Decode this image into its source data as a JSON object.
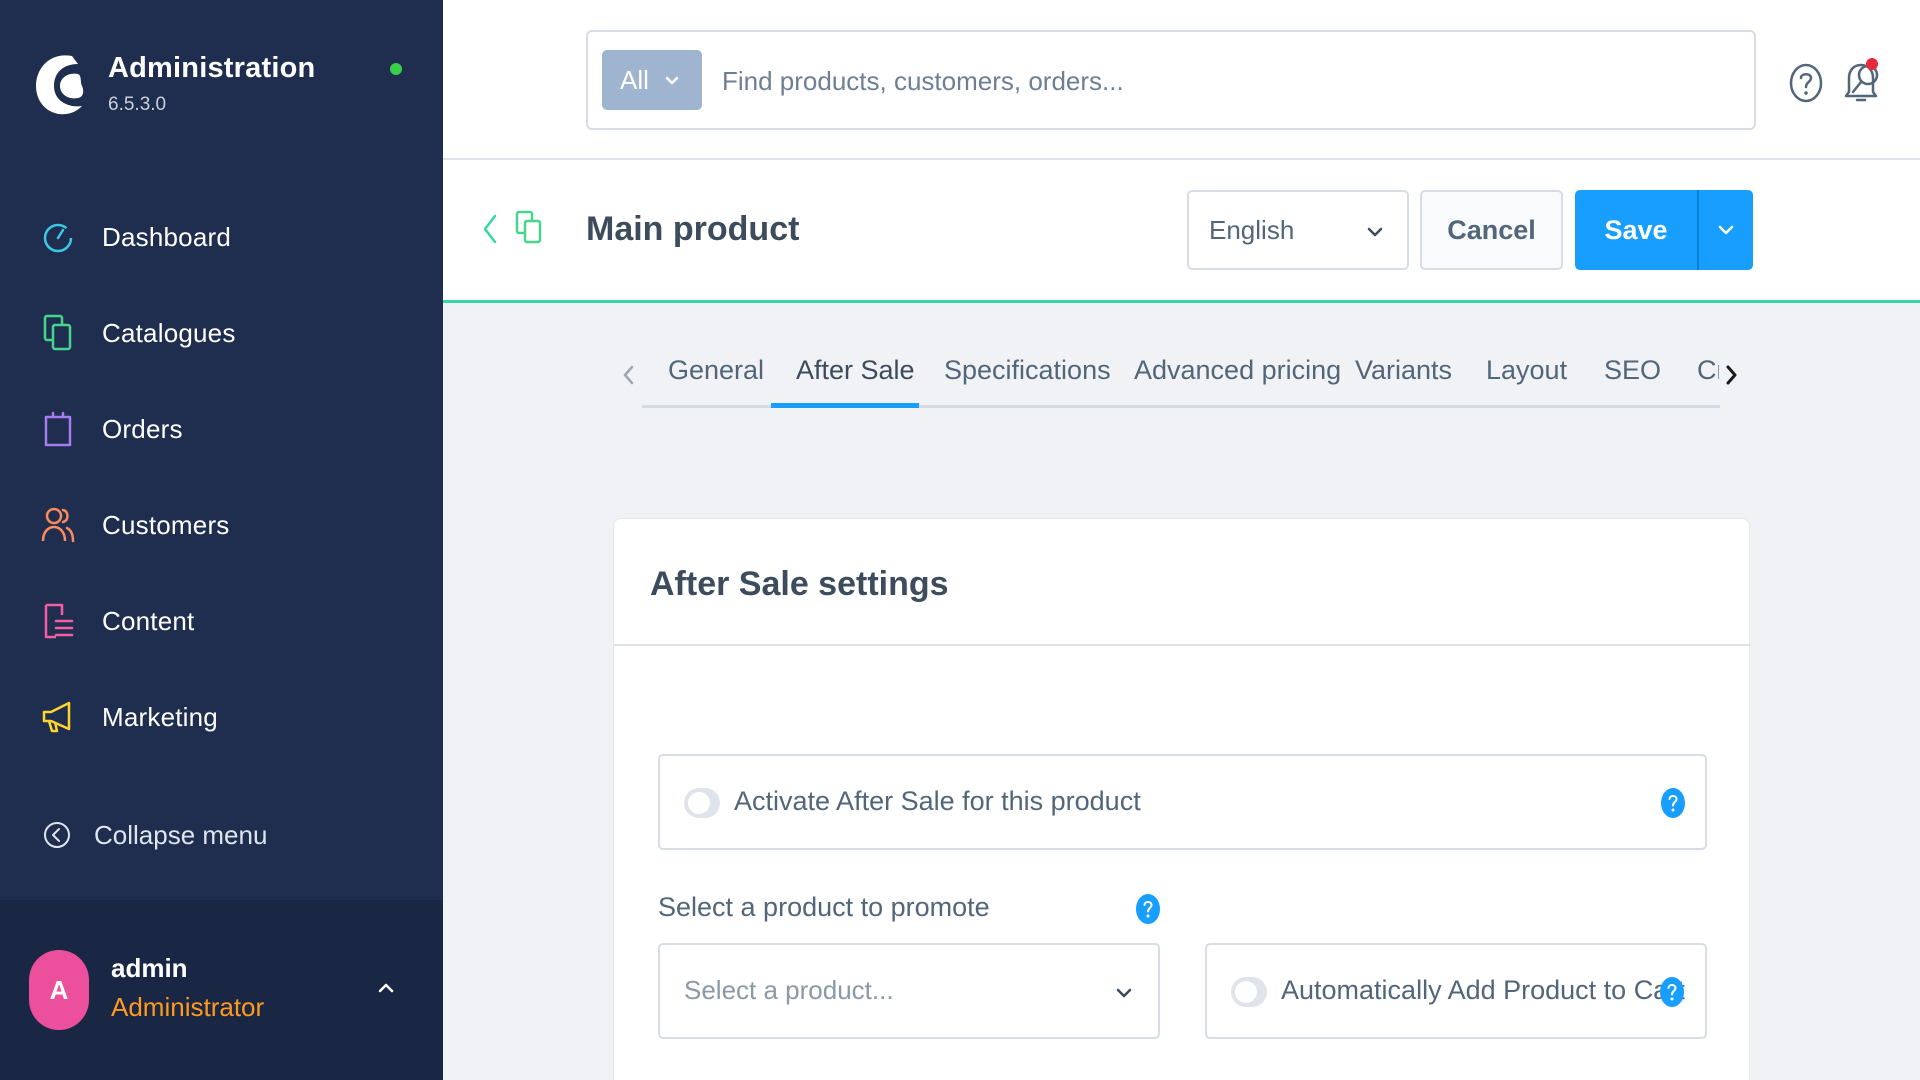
{
  "brand": {
    "title": "Administration",
    "version": "6.5.3.0",
    "status_color": "#37d046"
  },
  "sidebar": {
    "items": [
      {
        "label": "Dashboard",
        "icon": "dashboard-icon",
        "color": "#3ec8e8"
      },
      {
        "label": "Catalogues",
        "icon": "catalogues-icon",
        "color": "#45d68c"
      },
      {
        "label": "Orders",
        "icon": "orders-icon",
        "color": "#a57df0"
      },
      {
        "label": "Customers",
        "icon": "customers-icon",
        "color": "#ff8a5c"
      },
      {
        "label": "Content",
        "icon": "content-icon",
        "color": "#f55da5"
      },
      {
        "label": "Marketing",
        "icon": "marketing-icon",
        "color": "#ffd52e"
      }
    ],
    "collapse_label": "Collapse menu"
  },
  "user": {
    "initial": "A",
    "name": "admin",
    "role": "Administrator"
  },
  "search": {
    "type_label": "All",
    "placeholder": "Find products, customers, orders..."
  },
  "header": {
    "title": "Main product",
    "language": "English",
    "cancel_label": "Cancel",
    "save_label": "Save"
  },
  "tabs": [
    {
      "label": "General",
      "active": false
    },
    {
      "label": "After Sale",
      "active": true
    },
    {
      "label": "Specifications",
      "active": false
    },
    {
      "label": "Advanced pricing",
      "active": false
    },
    {
      "label": "Variants",
      "active": false
    },
    {
      "label": "Layout",
      "active": false
    },
    {
      "label": "SEO",
      "active": false
    },
    {
      "label": "Cr",
      "active": false
    }
  ],
  "card": {
    "title": "After Sale settings",
    "activate_label": "Activate After Sale for this product",
    "activate_on": false,
    "promote_label": "Select a product to promote",
    "product_placeholder": "Select a product...",
    "auto_add_label": "Automatically Add Product to Cart",
    "auto_add_on": false
  },
  "colors": {
    "accent": "#189eff",
    "header_border": "#37d6a4",
    "sidebar_bg": "#1f2d4e",
    "role_color": "#ff9a1f",
    "avatar_bg": "#ec4f9b",
    "notification_dot": "#e8293b"
  }
}
